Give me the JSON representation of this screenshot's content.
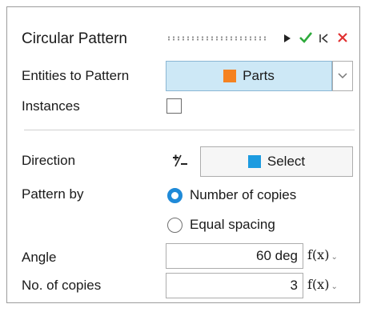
{
  "panel": {
    "title": "Circular Pattern",
    "colors": {
      "accent_green": "#2eaa3c",
      "accent_red": "#e03030",
      "radio_blue": "#1f8ad8",
      "parts_orange": "#f58220",
      "select_blue": "#1d9be0"
    }
  },
  "entities": {
    "label": "Entities to Pattern",
    "button_label": "Parts",
    "swatch_color": "#f58220"
  },
  "instances": {
    "label": "Instances",
    "checked": false
  },
  "direction": {
    "label": "Direction",
    "toggle_glyph": "+/−",
    "select_label": "Select",
    "swatch_color": "#1d9be0"
  },
  "pattern_by": {
    "label": "Pattern by",
    "options": [
      {
        "label": "Number of copies",
        "selected": true
      },
      {
        "label": "Equal spacing",
        "selected": false
      }
    ]
  },
  "angle": {
    "label": "Angle",
    "value": "60 deg"
  },
  "copies": {
    "label": "No. of copies",
    "value": "3"
  },
  "fx_label": "f(x)"
}
